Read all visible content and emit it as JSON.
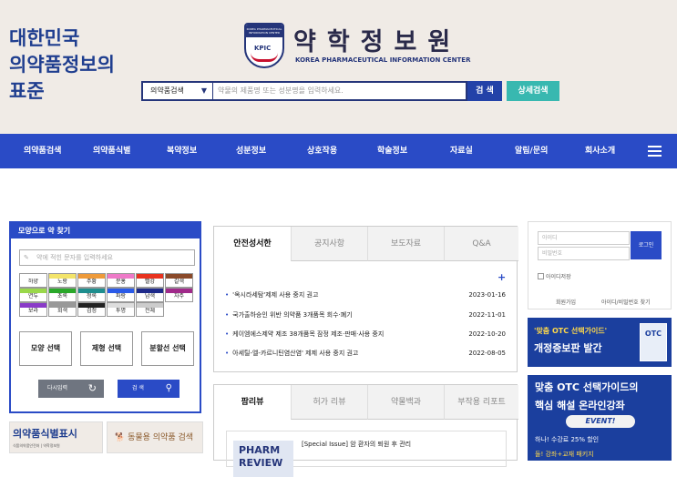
{
  "header": {
    "slogan_lines": [
      "대한민국",
      "의약품정보의",
      "표준"
    ],
    "logo_kpic": "KPIC",
    "logo_band_text": "KOREA PHARMACEUTICAL INFORMATION CENTER",
    "brand_ko": "약학정보원",
    "brand_en": "KOREA PHARMACEUTICAL INFORMATION CENTER",
    "search": {
      "select_value": "의약품검색",
      "placeholder": "약물의 제품명 또는 성분명을 입력하세요.",
      "search_button": "검 색",
      "advanced_button": "상세검색"
    }
  },
  "nav": {
    "items": [
      "의약품검색",
      "의약품식별",
      "복약정보",
      "성분정보",
      "상호작용",
      "학술정보",
      "자료실",
      "알림/문의",
      "회사소개"
    ]
  },
  "shape_search": {
    "title": "모양으로 약 찾기",
    "input_placeholder": "약에 적힌 문자를 입력하세요",
    "colors": [
      {
        "label": "하양",
        "color": "#ffffff"
      },
      {
        "label": "노랑",
        "color": "#f3e46a"
      },
      {
        "label": "주황",
        "color": "#ee9a3a"
      },
      {
        "label": "분홍",
        "color": "#ee7ac8"
      },
      {
        "label": "빨강",
        "color": "#e8321e"
      },
      {
        "label": "갈색",
        "color": "#8a4a2a"
      },
      {
        "label": "연두",
        "color": "#9ad84a"
      },
      {
        "label": "초록",
        "color": "#2aa82a"
      },
      {
        "label": "청록",
        "color": "#1e8e8e"
      },
      {
        "label": "파랑",
        "color": "#2a5ae8"
      },
      {
        "label": "남색",
        "color": "#1e2a8a"
      },
      {
        "label": "자주",
        "color": "#a02a8a"
      },
      {
        "label": "보라",
        "color": "#8a3ac8"
      },
      {
        "label": "회색",
        "color": "#999999"
      },
      {
        "label": "검정",
        "color": "#222222"
      },
      {
        "label": "투명",
        "color": "#dddddd"
      },
      {
        "label": "전체",
        "color": "#cccccc"
      }
    ],
    "buttons": [
      "모양 선택",
      "제형 선택",
      "분할선 선택"
    ],
    "reset_label": "다시입력",
    "search_label": "검 색"
  },
  "banners": {
    "identification_title": "의약품식별표시",
    "identification_sub": "식품의약품안전처 | 약학정보원",
    "animal_label": "동물용 의약품 검색"
  },
  "news": {
    "tabs": [
      "안전성서한",
      "공지사항",
      "보도자료",
      "Q&A"
    ],
    "active_tab": 0,
    "more_icon": "plus-icon",
    "items": [
      {
        "title": "'옥시라세탐'제제 사용 중지 권고",
        "date": "2023-01-16"
      },
      {
        "title": "국가출하승인 위반 의약품 3개품목 회수·폐기",
        "date": "2022-11-01"
      },
      {
        "title": "케이엠에스제약 제조 38개품목 잠정 제조·판매·사용 중지",
        "date": "2022-10-20"
      },
      {
        "title": "아세틸-엘-카르니틴염산염' 제제 사용 중지 권고",
        "date": "2022-08-05"
      }
    ]
  },
  "review": {
    "tabs": [
      "팜리뷰",
      "허가 리뷰",
      "약물백과",
      "부작용 리포트"
    ],
    "active_tab": 0,
    "card_logo": "PHARM REVIEW",
    "card_title": "[Special Issue] 암 환자의 퇴원 후 관리"
  },
  "login": {
    "id_placeholder": "아이디",
    "pw_placeholder": "비밀번호",
    "login_button": "로그인",
    "save_id": "아이디저장",
    "join": "회원가입",
    "find": "아이디/비밀번호 찾기"
  },
  "otc_banner1": {
    "line1": "'맞춤 OTC 선택가이드'",
    "line2": "개정증보판 발간",
    "book": "OTC"
  },
  "otc_banner2": {
    "line1": "맞춤 OTC 선택가이드의",
    "line2": "핵심 해설 온라인강좌",
    "event": "EVENT!",
    "line3": "하나! 수강료 25% 할인",
    "line4": "둘! 강좌+교재 패키지"
  }
}
